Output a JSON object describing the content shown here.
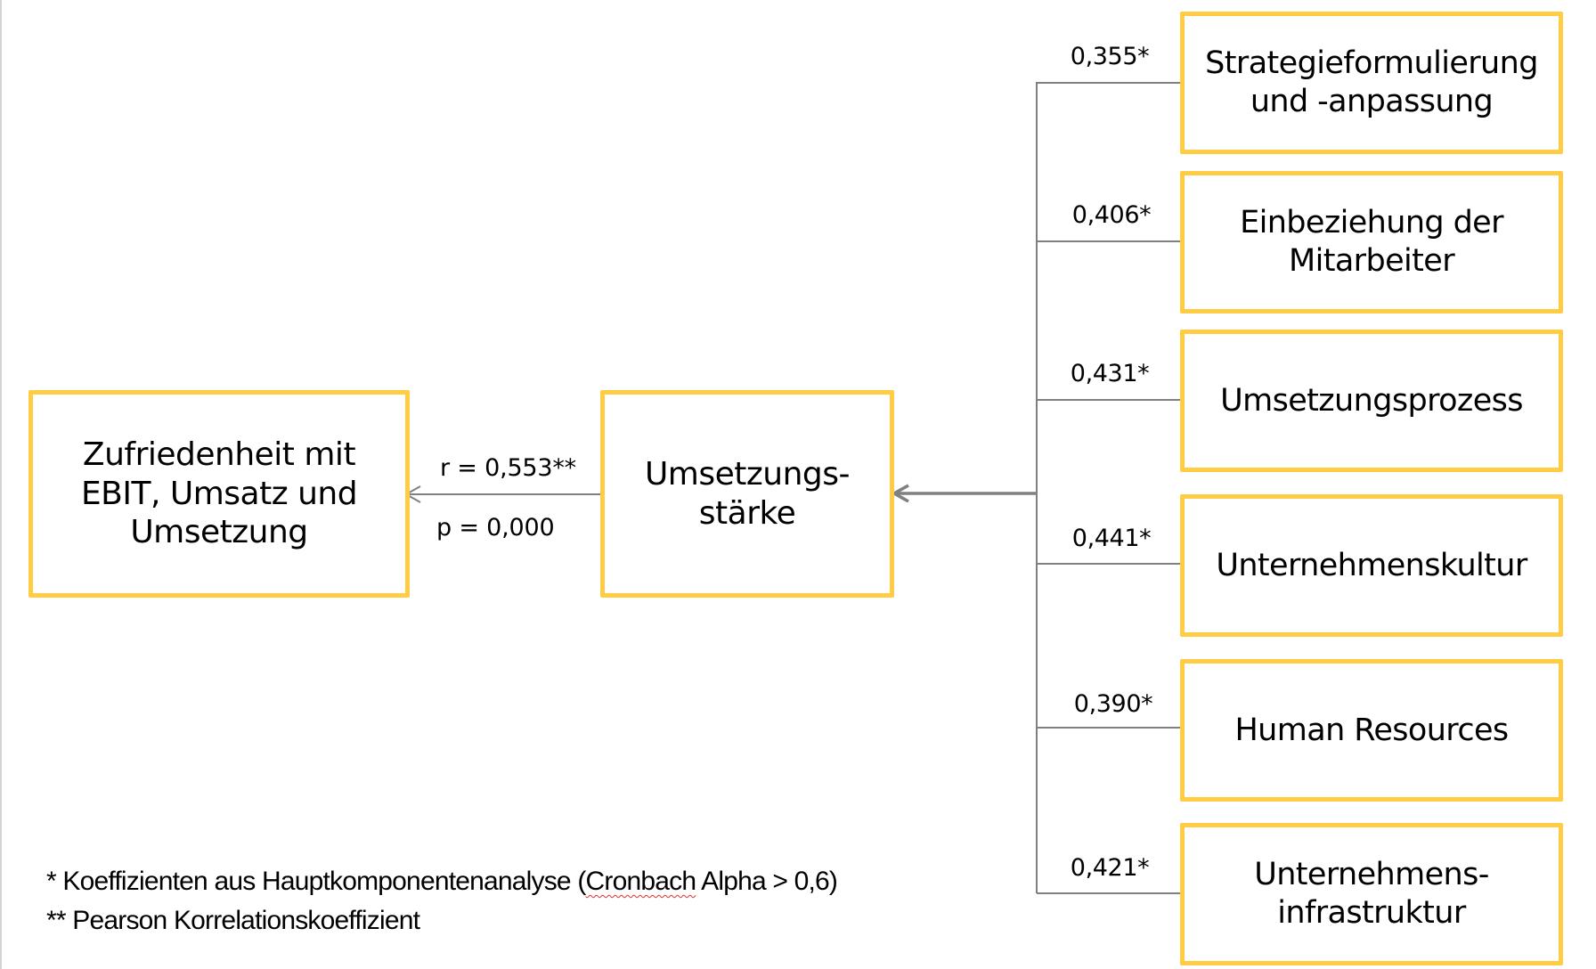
{
  "diagram": {
    "outcome": {
      "label": "Zufriedenheit mit\nEBIT, Umsatz und\nUmsetzung"
    },
    "construct": {
      "label": "Umsetzungs-\nstärke"
    },
    "correlation": {
      "r_label": "r = 0,553**",
      "p_label": "p = 0,000"
    },
    "factors": [
      {
        "label": "Strategieformulierung\nund -anpassung",
        "coefficient": "0,355*"
      },
      {
        "label": "Einbeziehung der\nMitarbeiter",
        "coefficient": "0,406*"
      },
      {
        "label": "Umsetzungsprozess",
        "coefficient": "0,431*"
      },
      {
        "label": "Unternehmenskultur",
        "coefficient": "0,441*"
      },
      {
        "label": "Human Resources",
        "coefficient": "0,390*"
      },
      {
        "label": "Unternehmens-\ninfrastruktur",
        "coefficient": "0,421*"
      }
    ],
    "colors": {
      "box_border": "#FFCC44",
      "connector": "#808080"
    }
  },
  "footnotes": {
    "line1_prefix": "* Koeffizienten aus Hauptkomponentenanalyse (",
    "line1_flagged": "Cronbach",
    "line1_suffix": " Alpha > 0,6)",
    "line2": "** Pearson Korrelationskoeffizient"
  }
}
